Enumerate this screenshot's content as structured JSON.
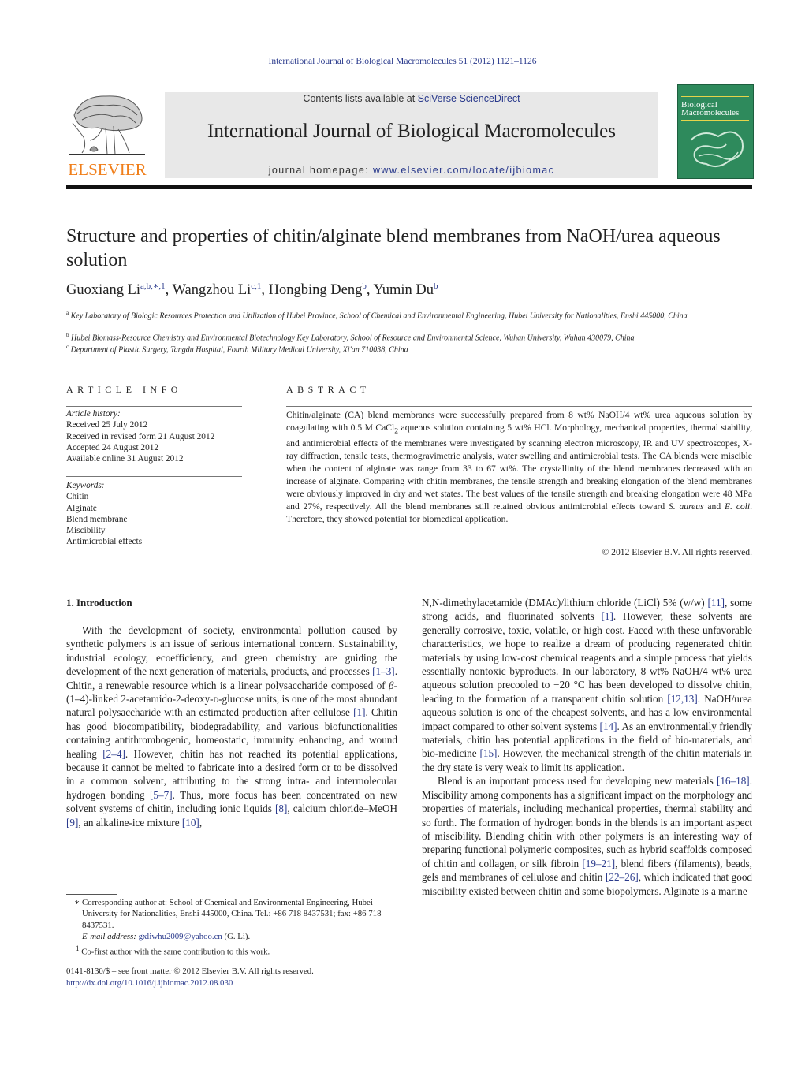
{
  "header": {
    "running_head": "International Journal of Biological Macromolecules 51 (2012) 1121–1126",
    "publisher_logo": "ELSEVIER",
    "contents_prefix": "Contents lists available at ",
    "contents_link": "SciVerse ScienceDirect",
    "journal_title": "International Journal of Biological Macromolecules",
    "homepage_prefix": "journal homepage: ",
    "homepage_link": "www.elsevier.com/locate/ijbiomac",
    "cover_title_line1": "Biological",
    "cover_title_line2": "Macromolecules"
  },
  "article": {
    "title": "Structure and properties of chitin/alginate blend membranes from NaOH/urea aqueous solution",
    "authors": [
      {
        "name": "Guoxiang Li",
        "sup": "a,b,∗,1"
      },
      {
        "name": "Wangzhou Li",
        "sup": "c,1"
      },
      {
        "name": "Hongbing Deng",
        "sup": "b"
      },
      {
        "name": "Yumin Du",
        "sup": "b"
      }
    ],
    "affiliations": [
      {
        "mark": "a",
        "text": "Key Laboratory of Biologic Resources Protection and Utilization of Hubei Province, School of Chemical and Environmental Engineering, Hubei University for Nationalities, Enshi 445000, China"
      },
      {
        "mark": "b",
        "text": "Hubei Biomass-Resource Chemistry and Environmental Biotechnology Key Laboratory, School of Resource and Environmental Science, Wuhan University, Wuhan 430079, China"
      },
      {
        "mark": "c",
        "text": "Department of Plastic Surgery, Tangdu Hospital, Fourth Military Medical University, Xi'an 710038, China"
      }
    ]
  },
  "article_info": {
    "heading": "ARTICLE INFO",
    "history_label": "Article history:",
    "history": [
      "Received 25 July 2012",
      "Received in revised form 21 August 2012",
      "Accepted 24 August 2012",
      "Available online 31 August 2012"
    ],
    "keywords_label": "Keywords:",
    "keywords": [
      "Chitin",
      "Alginate",
      "Blend membrane",
      "Miscibility",
      "Antimicrobial effects"
    ]
  },
  "abstract": {
    "heading": "ABSTRACT",
    "part1": "Chitin/alginate (CA) blend membranes were successfully prepared from 8 wt% NaOH/4 wt% urea aqueous solution by coagulating with 0.5 M CaCl",
    "sub": "2",
    "part2": " aqueous solution containing 5 wt% HCl. Morphology, mechanical properties, thermal stability, and antimicrobial effects of the membranes were investigated by scanning electron microscopy, IR and UV spectroscopes, X-ray diffraction, tensile tests, thermogravimetric analysis, water swelling and antimicrobial tests. The CA blends were miscible when the content of alginate was range from 33 to 67 wt%. The crystallinity of the blend membranes decreased with an increase of alginate. Comparing with chitin membranes, the tensile strength and breaking elongation of the blend membranes were obviously improved in dry and wet states. The best values of the tensile strength and breaking elongation were 48 MPa and 27%, respectively. All the blend membranes still retained obvious antimicrobial effects toward ",
    "species1": "S. aureus",
    "and": " and ",
    "species2": "E. coli",
    "part3": ". Therefore, they showed potential for biomedical application.",
    "copyright": "© 2012 Elsevier B.V. All rights reserved."
  },
  "intro": {
    "heading": "1.  Introduction",
    "left": {
      "s1": "With the development of society, environmental pollution caused by synthetic polymers is an issue of serious international concern. Sustainability, industrial ecology, ecoefficiency, and green chemistry are guiding the development of the next generation of materials, products, and processes ",
      "c1": "[1–3]",
      "s2": ". Chitin, a renewable resource which is a linear polysaccharide composed of ",
      "beta": "β",
      "s3": "-(1–4)-linked 2-acetamido-2-deoxy-",
      "d": "d",
      "s4": "-glucose units, is one of the most abundant natural polysaccharide with an estimated production after cellulose ",
      "c2": "[1]",
      "s5": ". Chitin has good biocompatibility, biodegradability, and various biofunctionalities containing antithrombogenic, homeostatic, immunity enhancing, and wound healing ",
      "c3": "[2–4]",
      "s6": ". However, chitin has not reached its potential applications, because it cannot be melted to fabricate into a desired form or to be dissolved in a common solvent, attributing to the strong intra- and intermolecular hydrogen bonding ",
      "c4": "[5–7]",
      "s7": ". Thus, more focus has been concentrated on new solvent systems of chitin, including ionic liquids ",
      "c5": "[8]",
      "s8": ", calcium chloride–MeOH ",
      "c6": "[9]",
      "s9": ", an alkaline-ice mixture ",
      "c7": "[10]",
      "s10": ","
    },
    "right": {
      "s1": "N,N-dimethylacetamide (DMAc)/lithium chloride (LiCl) 5% (w/w) ",
      "c1": "[11]",
      "s2": ", some strong acids, and fluorinated solvents ",
      "c2": "[1]",
      "s3": ". However, these solvents are generally corrosive, toxic, volatile, or high cost. Faced with these unfavorable characteristics, we hope to realize a dream of producing regenerated chitin materials by using low-cost chemical reagents and a simple process that yields essentially nontoxic byproducts. In our laboratory, 8 wt% NaOH/4 wt% urea aqueous solution precooled to −20 °C has been developed to dissolve chitin, leading to the formation of a transparent chitin solution ",
      "c3": "[12,13]",
      "s4": ". NaOH/urea aqueous solution is one of the cheapest solvents, and has a low environmental impact compared to other solvent systems ",
      "c4": "[14]",
      "s5": ". As an environmentally friendly materials, chitin has potential applications in the field of bio-materials, and bio-medicine ",
      "c5": "[15]",
      "s6": ". However, the mechanical strength of the chitin materials in the dry state is very weak to limit its application.",
      "p2s1": "Blend is an important process used for developing new materials ",
      "p2c1": "[16–18]",
      "p2s2": ". Miscibility among components has a significant impact on the morphology and properties of materials, including mechanical properties, thermal stability and so forth. The formation of hydrogen bonds in the blends is an important aspect of miscibility. Blending chitin with other polymers is an interesting way of preparing functional polymeric composites, such as hybrid scaffolds composed of chitin and collagen, or silk fibroin ",
      "p2c2": "[19–21]",
      "p2s3": ", blend fibers (filaments), beads, gels and membranes of cellulose and chitin ",
      "p2c3": "[22–26]",
      "p2s4": ", which indicated that good miscibility existed between chitin and some biopolymers. Alginate is a marine"
    }
  },
  "footnotes": {
    "corresponding": "∗ Corresponding author at: School of Chemical and Environmental Engineering, Hubei University for Nationalities, Enshi 445000, China. Tel.: +86 718 8437531; fax: +86 718 8437531.",
    "email_label": "E-mail address: ",
    "email": "gxliwhu2009@yahoo.cn",
    "email_suffix": " (G. Li).",
    "cofirst_mark": "1",
    "cofirst": " Co-first author with the same contribution to this work.",
    "front_matter": "0141-8130/$ – see front matter © 2012 Elsevier B.V. All rights reserved.",
    "doi": "http://dx.doi.org/10.1016/j.ijbiomac.2012.08.030"
  },
  "colors": {
    "link": "#2a3a8c",
    "elsevier_orange": "#f07f1b",
    "banner_gray": "#e8e8e8",
    "cover_green": "#2e8a5c"
  }
}
